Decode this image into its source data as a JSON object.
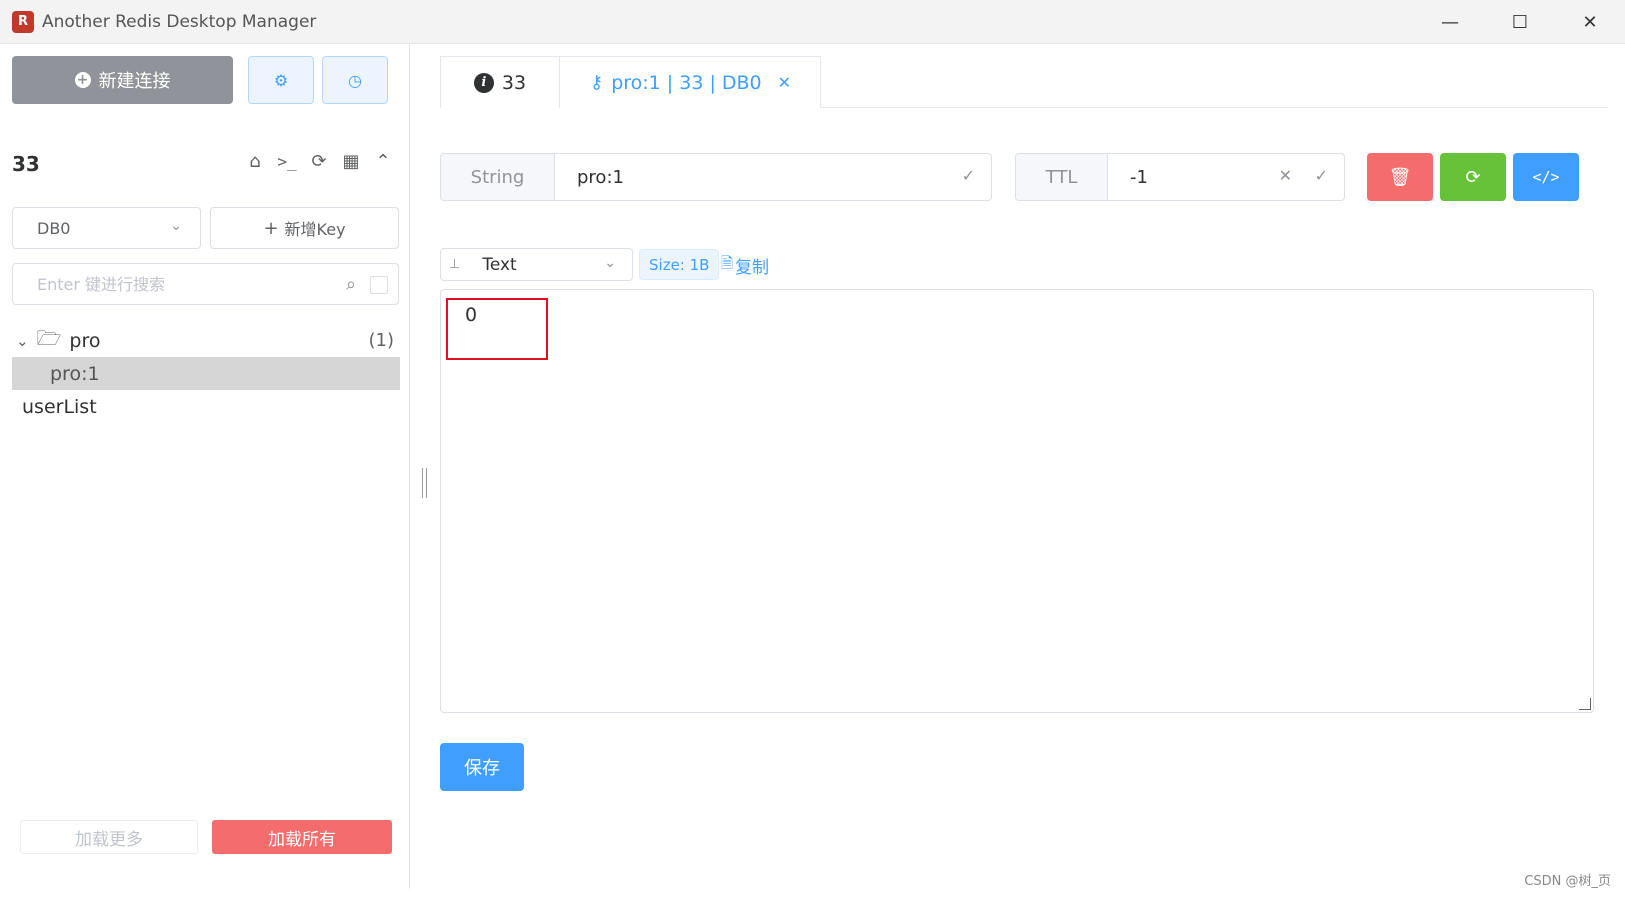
{
  "window": {
    "title": "Another Redis Desktop Manager",
    "app_icon": "🐞",
    "minimize": "—",
    "maximize": "☐",
    "close": "✕"
  },
  "sidebar": {
    "new_connection_label": "新建连接",
    "connection_name": "33",
    "db_selected": "DB0",
    "add_key_label": "新增Key",
    "search_placeholder": "Enter 键进行搜索",
    "tree": [
      {
        "label": "pro",
        "count": "(1)",
        "type": "folder",
        "expanded": true
      },
      {
        "label": "pro:1",
        "type": "key",
        "selected": true
      },
      {
        "label": "userList",
        "type": "key"
      }
    ],
    "load_more_label": "加载更多",
    "load_all_label": "加载所有"
  },
  "tabs": [
    {
      "label": "33",
      "icon": "info-icon"
    },
    {
      "label": "pro:1 | 33 | DB0",
      "icon": "key-icon",
      "active": true
    }
  ],
  "key_detail": {
    "type_label": "String",
    "key_name": "pro:1",
    "ttl_label": "TTL",
    "ttl_value": "-1",
    "format_label": "Text",
    "size_label": "Size: 1B",
    "copy_label": "复制",
    "value": "0",
    "save_label": "保存"
  },
  "colors": {
    "primary": "#409eff",
    "danger": "#f56c6c",
    "success": "#67c23a",
    "info": "#909399",
    "highlight": "#e0101f"
  },
  "watermark": "CSDN @树_页"
}
